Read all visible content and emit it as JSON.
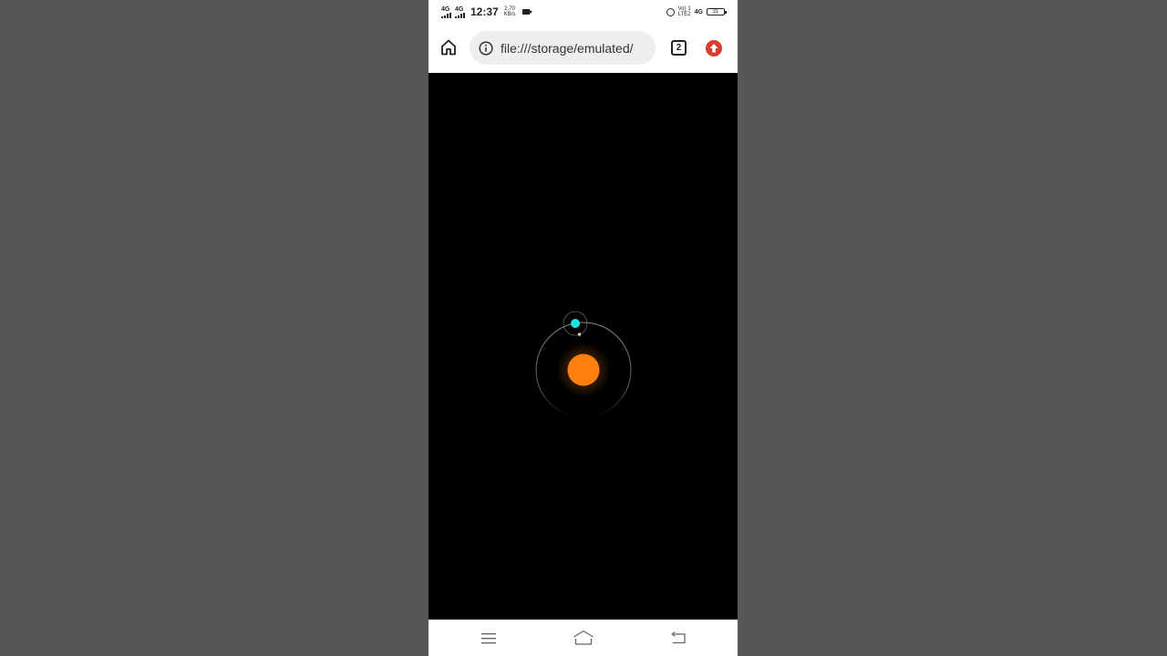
{
  "status_bar": {
    "network_1": "4G",
    "network_2": "4G",
    "time": "12:37",
    "speed_value": "2.70",
    "speed_unit": "KB/s",
    "volte_line1": "Vo) 1",
    "volte_line2": "LTE2",
    "network_3": "4G",
    "battery": "31",
    "icons": [
      "signal-icon",
      "signal-icon",
      "video-camera-icon",
      "alarm-icon",
      "battery-icon"
    ]
  },
  "browser": {
    "url": "file:///storage/emulated/",
    "tab_count": "2",
    "icons": [
      "home-icon",
      "info-icon",
      "tabs-icon",
      "update-icon"
    ],
    "update_color": "#d93b2f"
  },
  "scene": {
    "background": "#000000",
    "sun_color": "#ff7f0e",
    "planet_color": "#19e3e3",
    "orbit_color": "#9a9a9a"
  },
  "nav": {
    "icons": [
      "menu-icon",
      "home-outline-icon",
      "back-icon"
    ]
  }
}
